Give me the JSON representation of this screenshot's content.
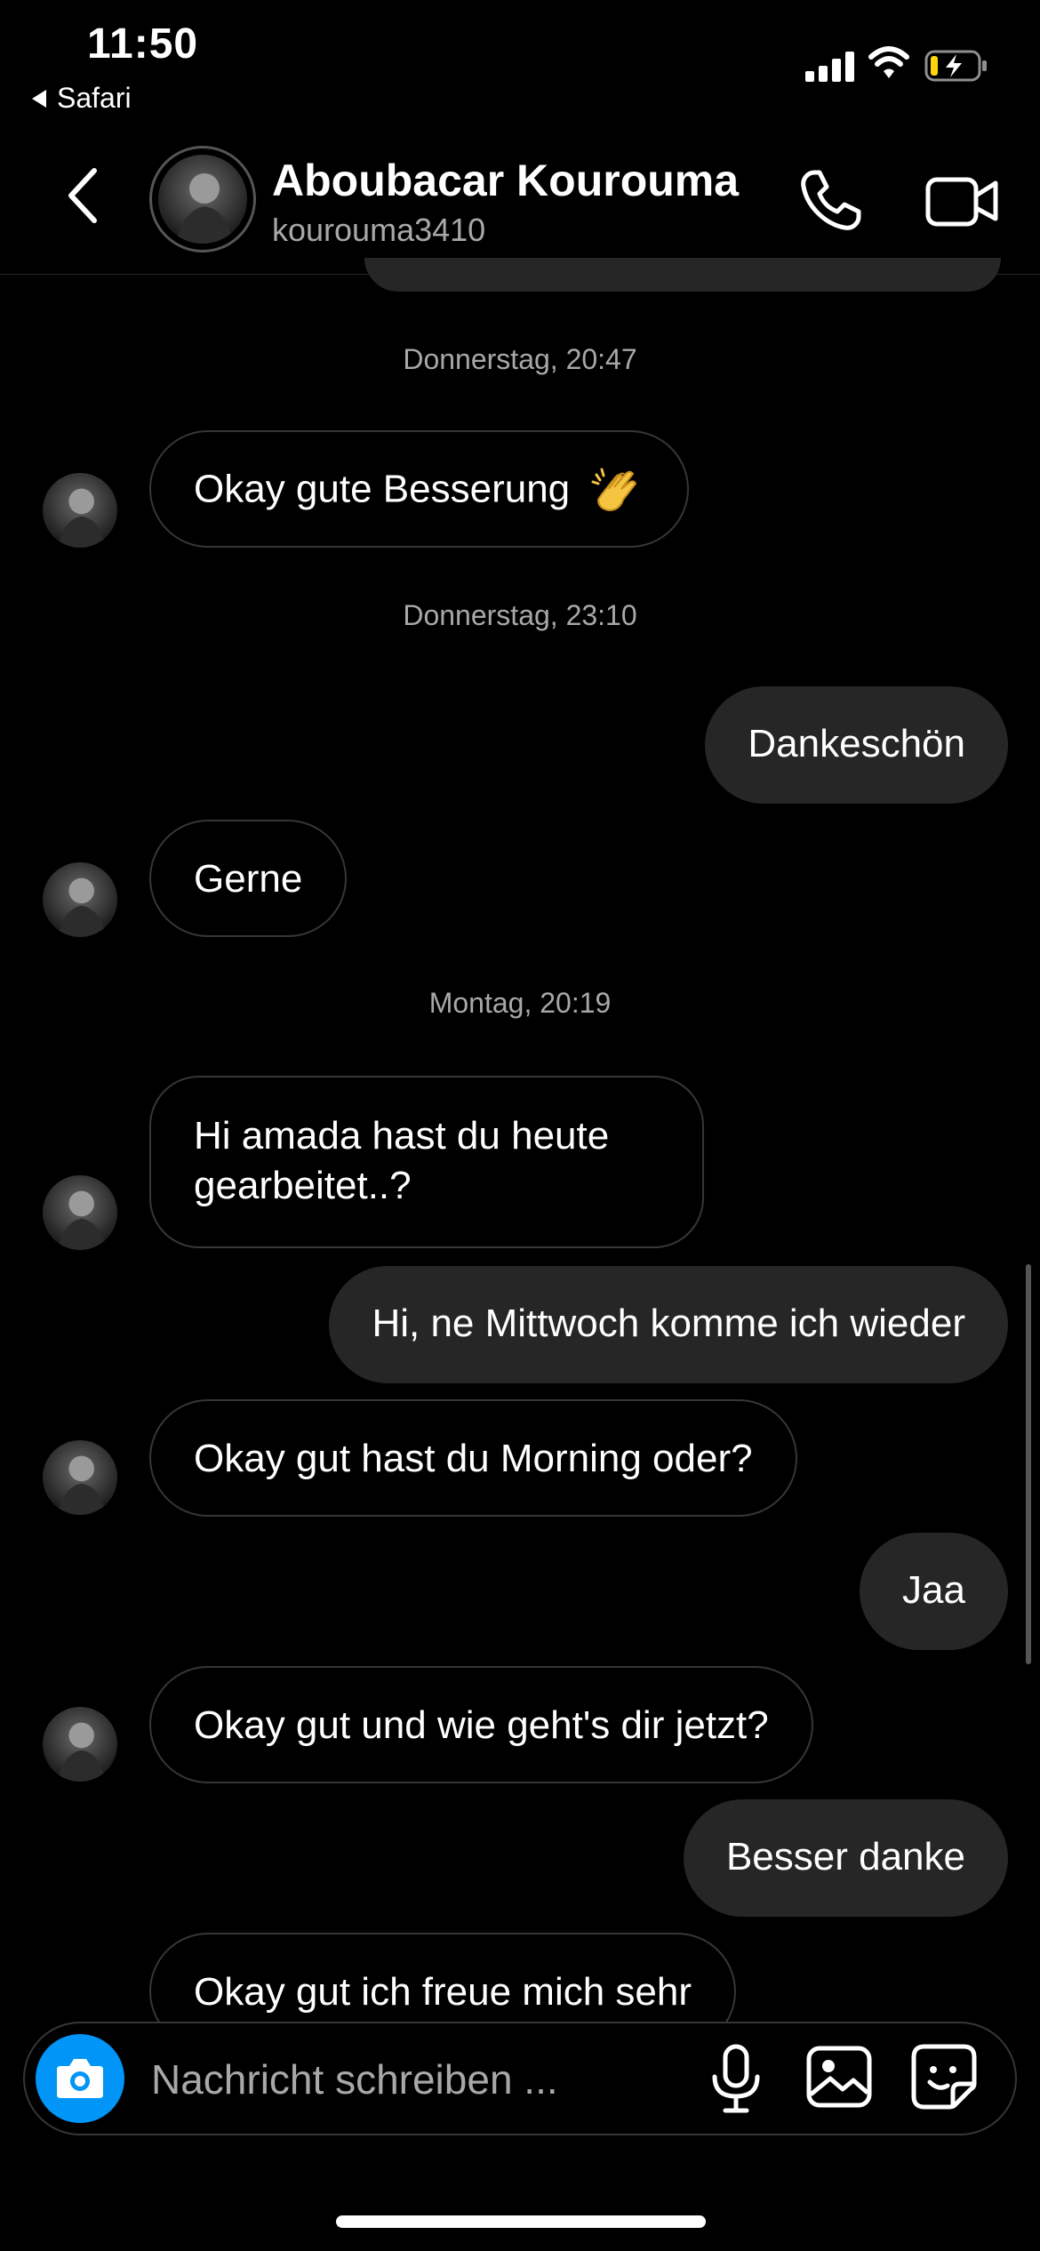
{
  "status_bar": {
    "time": "11:50",
    "back_app": "Safari"
  },
  "header": {
    "contact_name": "Aboubacar Kourouma",
    "contact_username": "kourouma3410",
    "icons": [
      "back-chevron-icon",
      "phone-icon",
      "video-camera-icon"
    ]
  },
  "messages": {
    "ts1": "Donnerstag, 20:47",
    "m1": "Okay gute Besserung",
    "m1_emoji": "clapping-hands-emoji",
    "ts2": "Donnerstag, 23:10",
    "m2": "Dankeschön",
    "m3": "Gerne",
    "ts3": "Montag, 20:19",
    "m4_line1": "Hi amada hast du heute",
    "m4_line2": "gearbeitet..?",
    "m5": "Hi, ne Mittwoch komme ich wieder",
    "m6": "Okay gut hast du Morning oder?",
    "m7": "Jaa",
    "m8": "Okay gut und wie geht's dir jetzt?",
    "m9": "Besser danke",
    "m10": "Okay gut ich freue mich sehr"
  },
  "composer": {
    "placeholder": "Nachricht schreiben ...",
    "icons": [
      "camera-icon",
      "microphone-icon",
      "gallery-icon",
      "sticker-icon"
    ]
  },
  "colors": {
    "background": "#000000",
    "outgoing_bubble": "#262626",
    "incoming_border": "#363636",
    "secondary_text": "#a8a8a8",
    "camera_accent": "#0095f6",
    "battery_charge": "#ffd60a"
  }
}
